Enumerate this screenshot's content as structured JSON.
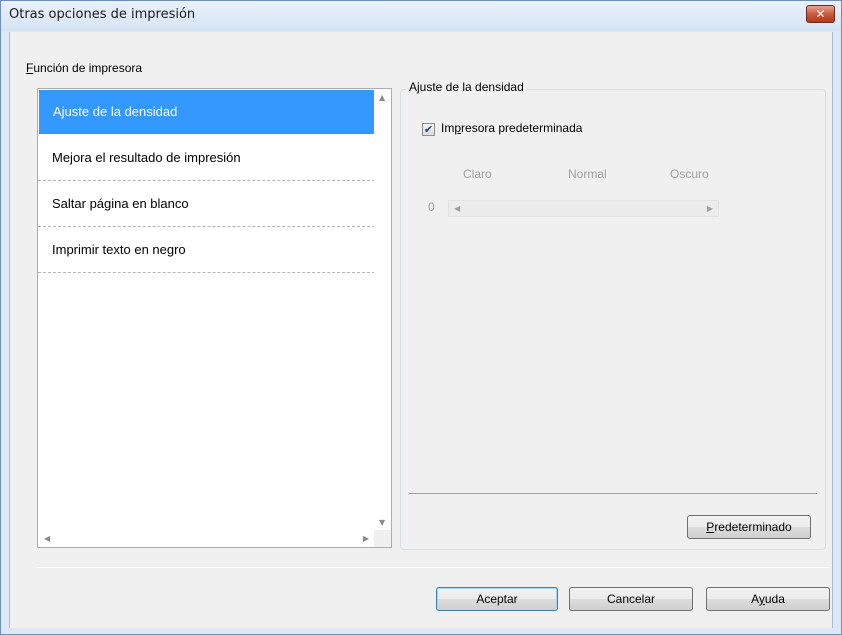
{
  "window": {
    "title": "Otras opciones de impresión",
    "close_glyph": "✕"
  },
  "function_group": {
    "label_accel": "F",
    "label_rest": "unción de impresora",
    "items": [
      {
        "label": "Ajuste de la densidad",
        "selected": true
      },
      {
        "label": "Mejora el resultado de impresión",
        "selected": false
      },
      {
        "label": "Saltar página en blanco",
        "selected": false
      },
      {
        "label": "Imprimir texto en negro",
        "selected": false
      }
    ]
  },
  "density_group": {
    "legend": "Ajuste de la densidad",
    "checkbox_checked": true,
    "checkbox_label_pre": "Im",
    "checkbox_label_accel": "p",
    "checkbox_label_post": "resora predeterminada",
    "scale": {
      "light": "Claro",
      "normal": "Normal",
      "dark": "Oscuro"
    },
    "slider_value": "0",
    "default_button_accel": "P",
    "default_button_rest": "redeterminado"
  },
  "footer": {
    "ok_label": "Aceptar",
    "cancel_label": "Cancelar",
    "help_pre": "A",
    "help_accel": "y",
    "help_post": "uda"
  },
  "icons": {
    "close": "close-icon",
    "scroll_up": "scroll-up-arrow-icon",
    "scroll_down": "scroll-down-arrow-icon",
    "scroll_left": "scroll-left-arrow-icon",
    "scroll_right": "scroll-right-arrow-icon"
  },
  "colors": {
    "selection": "#3399ff",
    "title_bg": "#dce8f5",
    "close_button": "#c75a3f"
  }
}
